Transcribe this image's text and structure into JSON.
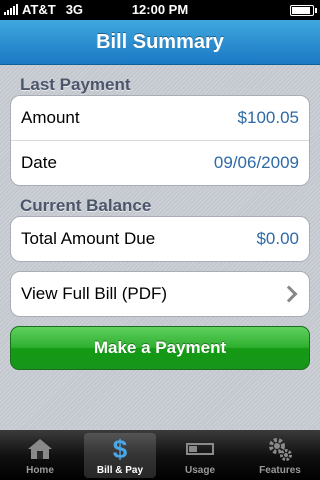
{
  "status_bar": {
    "carrier": "AT&T",
    "network": "3G",
    "time": "12:00 PM"
  },
  "nav": {
    "title": "Bill Summary"
  },
  "last_payment": {
    "header": "Last Payment",
    "rows": [
      {
        "label": "Amount",
        "value": "$100.05"
      },
      {
        "label": "Date",
        "value": "09/06/2009"
      }
    ]
  },
  "current_balance": {
    "header": "Current Balance",
    "total_label": "Total Amount Due",
    "total_value": "$0.00"
  },
  "view_bill": {
    "label": "View Full Bill (PDF)"
  },
  "pay_button": {
    "label": "Make a Payment"
  },
  "tabs": [
    {
      "label": "Home",
      "icon": "house-icon"
    },
    {
      "label": "Bill & Pay",
      "icon": "dollar-icon",
      "active": true
    },
    {
      "label": "Usage",
      "icon": "usage-meter-icon"
    },
    {
      "label": "Features",
      "icon": "gears-icon"
    }
  ],
  "colors": {
    "accent_blue": "#1b79c4",
    "value_blue": "#2e6aa6",
    "pay_green": "#30b030"
  }
}
